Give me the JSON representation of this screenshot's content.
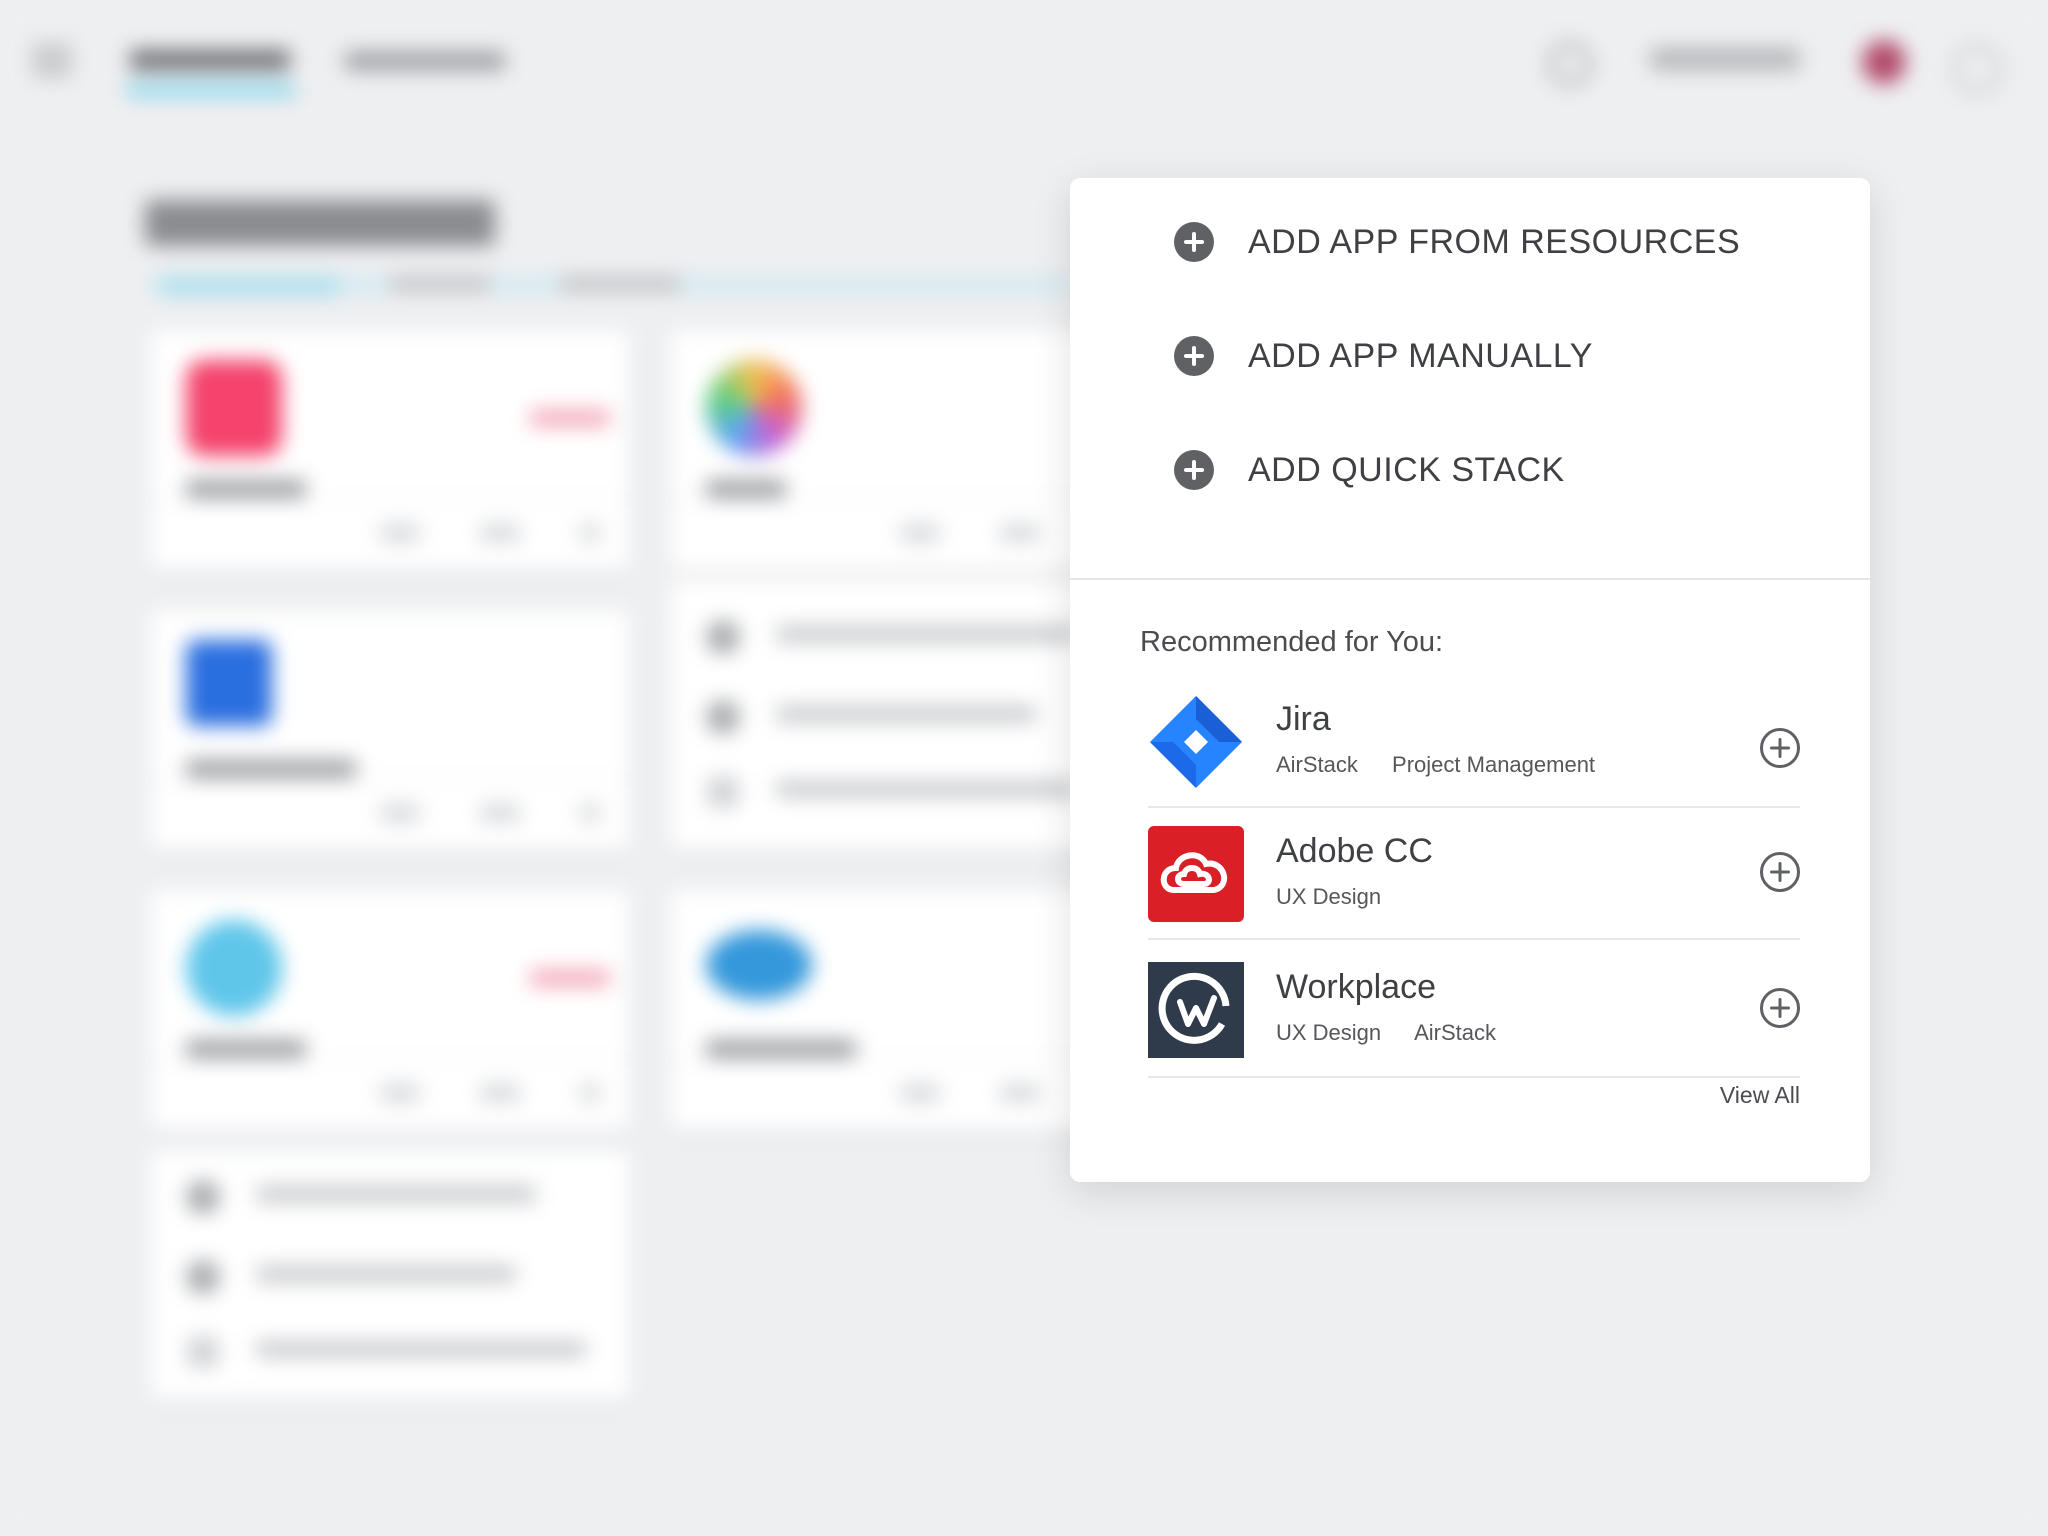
{
  "popover": {
    "actions": [
      {
        "label": "ADD APP FROM RESOURCES"
      },
      {
        "label": "ADD APP MANUALLY"
      },
      {
        "label": "ADD QUICK STACK"
      }
    ],
    "recommended_heading": "Recommended for You:",
    "recommended": [
      {
        "name": "Jira",
        "tags": [
          "AirStack",
          "Project Management"
        ],
        "icon": "jira-logo-icon"
      },
      {
        "name": "Adobe CC",
        "tags": [
          "UX Design"
        ],
        "icon": "adobe-cc-logo-icon"
      },
      {
        "name": "Workplace",
        "tags": [
          "UX Design",
          "AirStack"
        ],
        "icon": "workplace-logo-icon"
      }
    ],
    "view_all_label": "View All"
  },
  "colors": {
    "jira_blue": "#2684ff",
    "adobe_red": "#da1f26",
    "workplace_dark": "#2f3b4a",
    "accent_underline": "#7dd3ea"
  }
}
